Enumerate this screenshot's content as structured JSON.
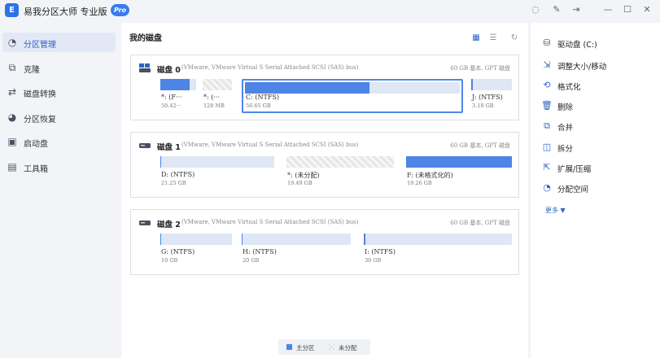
{
  "app": {
    "logo_char": "E",
    "title": "易我分区大师 专业版",
    "badge": "Pro"
  },
  "window_controls": {
    "skin_icon": "◌",
    "feedback_icon": "✎",
    "export_icon": "⇥",
    "minimize_icon": "—",
    "maximize_icon": "☐",
    "close_icon": "✕"
  },
  "sidebar": {
    "items": [
      {
        "label": "分区管理",
        "icon": "◔"
      },
      {
        "label": "克隆",
        "icon": "⧉"
      },
      {
        "label": "磁盘转换",
        "icon": "⇄"
      },
      {
        "label": "分区恢复",
        "icon": "◕"
      },
      {
        "label": "启动盘",
        "icon": "▣"
      },
      {
        "label": "工具箱",
        "icon": "▤"
      }
    ]
  },
  "main": {
    "title": "我的磁盘",
    "view_icons": [
      "▦",
      "☰",
      "↻"
    ]
  },
  "disks": [
    {
      "name": "磁盘 0",
      "desc": "(VMware,  VMware Virtual S Serial Attached SCSI (SAS) bus)",
      "size": "60 GB 基本, GPT 磁盘",
      "partitions": [
        {
          "label": "*: (F···",
          "size": "50.42···",
          "used": 0.82,
          "type": "primary"
        },
        {
          "label": "*: (···",
          "size": "128 MB",
          "used": 0,
          "type": "unallocated"
        },
        {
          "label": "C: (NTFS)",
          "size": "56.65 GB",
          "used": 0.58,
          "type": "primary",
          "selected": true
        },
        {
          "label": "J: (NTFS)",
          "size": "3.18 GB",
          "used": 0.04,
          "type": "primary"
        }
      ]
    },
    {
      "name": "磁盘 1",
      "desc": "(VMware,  VMware Virtual S Serial Attached SCSI (SAS) bus)",
      "size": "60 GB 基本, GPT 磁盘",
      "partitions": [
        {
          "label": "D: (NTFS)",
          "size": "21.25 GB",
          "used": 0.01,
          "type": "primary"
        },
        {
          "label": "*: (未分配)",
          "size": "19.49 GB",
          "used": 0,
          "type": "unallocated"
        },
        {
          "label": "F: (未格式化的)",
          "size": "19.26 GB",
          "used": 1.0,
          "type": "primary"
        }
      ]
    },
    {
      "name": "磁盘 2",
      "desc": "(VMware,  VMware Virtual S Serial Attached SCSI (SAS) bus)",
      "size": "60 GB 基本, GPT 磁盘",
      "partitions": [
        {
          "label": "G: (NTFS)",
          "size": "10 GB",
          "used": 0.01,
          "type": "primary"
        },
        {
          "label": "H: (NTFS)",
          "size": "20 GB",
          "used": 0.01,
          "type": "primary"
        },
        {
          "label": "I: (NTFS)",
          "size": "30 GB",
          "used": 0.01,
          "type": "primary"
        }
      ]
    }
  ],
  "legend": {
    "primary": "主分区",
    "unallocated": "未分配",
    "primary_color": "#4d84e6"
  },
  "actions": {
    "items": [
      {
        "label": "驱动盘  (C:)",
        "icon": "⛁"
      },
      {
        "label": "调整大小/移动",
        "icon": "⇲"
      },
      {
        "label": "格式化",
        "icon": "⟲"
      },
      {
        "label": "删除",
        "icon": "🗑"
      },
      {
        "label": "合并",
        "icon": "⧉"
      },
      {
        "label": "拆分",
        "icon": "◫"
      },
      {
        "label": "扩展/压缩",
        "icon": "⇱"
      },
      {
        "label": "分配空间",
        "icon": "◔"
      }
    ],
    "more": "更多 ▼"
  }
}
